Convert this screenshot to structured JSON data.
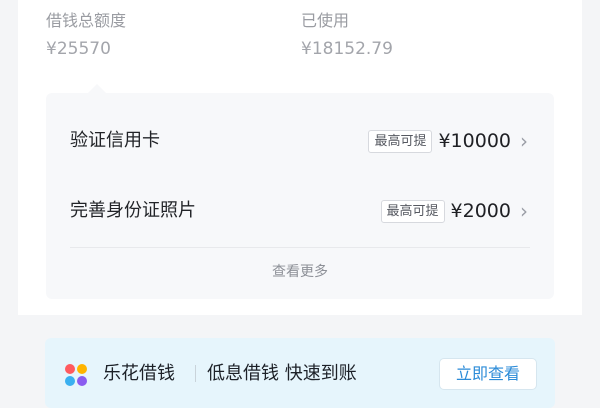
{
  "summary": {
    "total_label": "借钱总额度",
    "total_value": "¥25570",
    "used_label": "已使用",
    "used_value": "¥18152.79"
  },
  "boost_items": [
    {
      "label": "验证信用卡",
      "badge": "最高可提",
      "amount": "¥10000",
      "icon": "chevron-right-icon"
    },
    {
      "label": "完善身份证照片",
      "badge": "最高可提",
      "amount": "¥2000",
      "icon": "chevron-right-icon"
    }
  ],
  "more_label": "查看更多",
  "promo": {
    "brand": "乐花借钱",
    "slogan": "低息借钱 快速到账",
    "cta": "立即查看",
    "logo_icon": "lehua-logo-icon",
    "logo_colors": [
      "#ff5a5f",
      "#ffb400",
      "#3ab0f0",
      "#8a5cf0"
    ]
  },
  "colors": {
    "banner_bg": "#e6f5fc",
    "cta_text": "#2b8bd8"
  }
}
